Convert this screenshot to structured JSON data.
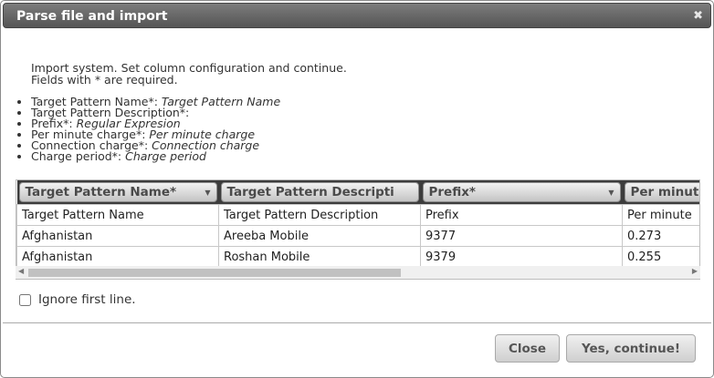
{
  "dialog": {
    "title": "Parse file and import",
    "close_glyph": "✖"
  },
  "intro": {
    "line1": "Import system. Set column configuration and continue.",
    "line2": "Fields with * are required."
  },
  "fields": [
    {
      "label": "Target Pattern Name*: ",
      "value": "Target Pattern Name"
    },
    {
      "label": "Target Pattern Description*: ",
      "value": ""
    },
    {
      "label": "Prefix*: ",
      "value": "Regular Expresion"
    },
    {
      "label": "Per minute charge*: ",
      "value": "Per minute charge"
    },
    {
      "label": "Connection charge*: ",
      "value": "Connection charge"
    },
    {
      "label": "Charge period*: ",
      "value": "Charge period"
    }
  ],
  "grid": {
    "columns": [
      "Target Pattern Name*",
      "Target Pattern Descripti",
      "Prefix*",
      "Per minut"
    ],
    "rows": [
      [
        "Target Pattern Name",
        "Target Pattern Description",
        "Prefix",
        "Per minute"
      ],
      [
        "Afghanistan",
        "Areeba Mobile",
        "9377",
        "0.273"
      ],
      [
        "Afghanistan",
        "Roshan Mobile",
        "9379",
        "0.255"
      ]
    ],
    "scroll_left_glyph": "◀",
    "scroll_right_glyph": "▶",
    "dropdown_glyph": "▼"
  },
  "options": {
    "ignore_first_line_label": "Ignore first line."
  },
  "buttons": {
    "close_label": "Close",
    "continue_label": "Yes, continue!"
  },
  "colors": {
    "titlebar": "#5e5e5e",
    "header_row": "#3d3d3d",
    "button_text": "#555555"
  }
}
